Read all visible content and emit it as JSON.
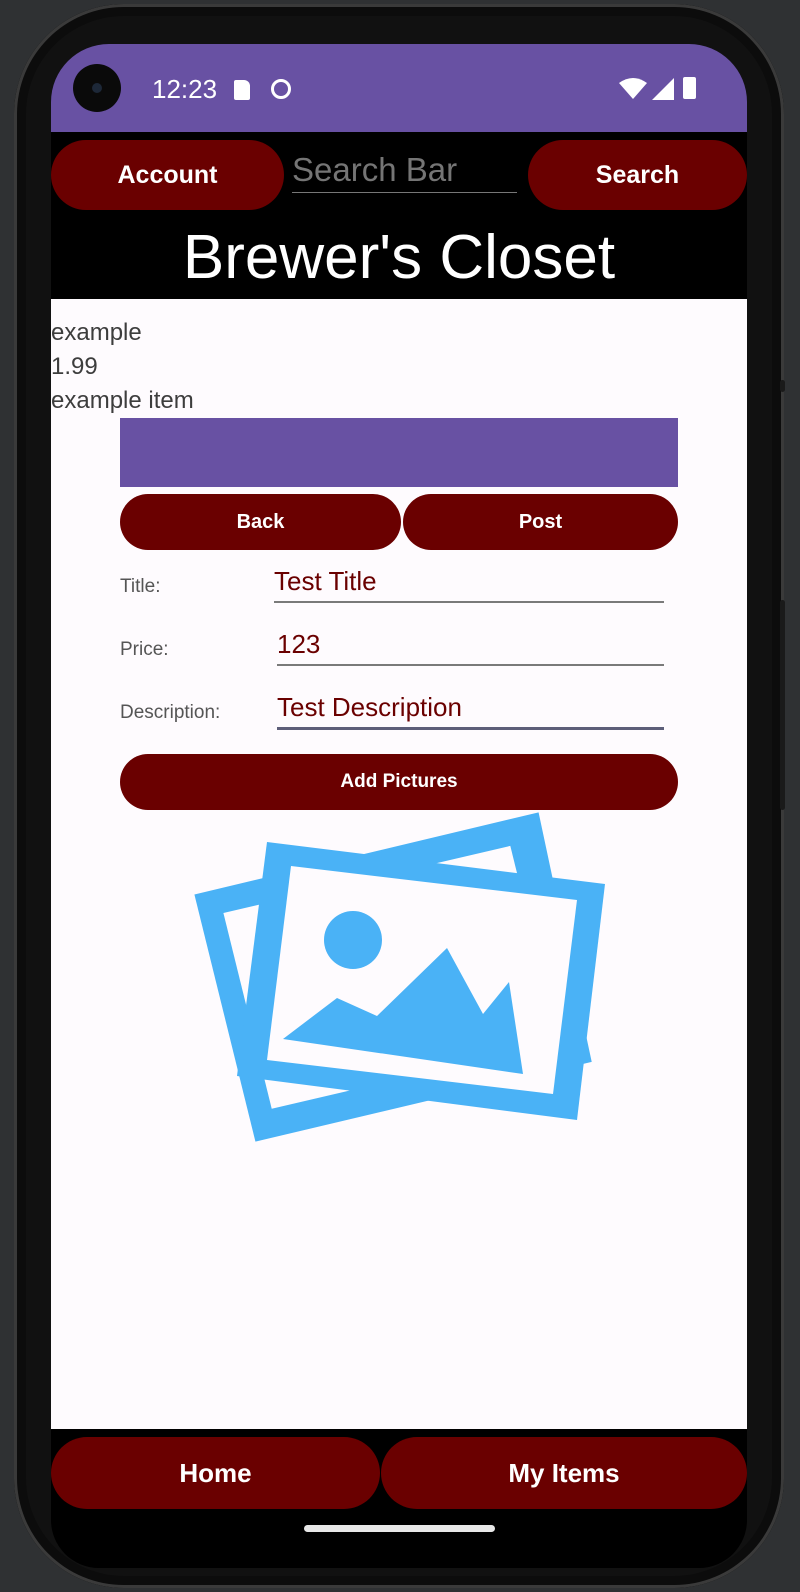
{
  "status_bar": {
    "time": "12:23",
    "color": "#6851a3"
  },
  "header": {
    "account_label": "Account",
    "search_placeholder": "Search Bar",
    "search_label": "Search",
    "app_title": "Brewer's Closet"
  },
  "item": {
    "name": "example",
    "price": "1.99",
    "description": "example item"
  },
  "actions": {
    "back_label": "Back",
    "post_label": "Post",
    "add_pictures_label": "Add Pictures"
  },
  "form": {
    "title_label": "Title:",
    "title_value": "Test Title",
    "price_label": "Price:",
    "price_value": "123",
    "description_label": "Description:",
    "description_value": "Test Description"
  },
  "bottom_nav": {
    "home_label": "Home",
    "my_items_label": "My Items"
  },
  "colors": {
    "button": "#6a0000",
    "accent": "#6851a3",
    "icon": "#4ab2f6"
  },
  "icons": [
    "camera-icon",
    "sd-card-icon",
    "face-icon",
    "wifi-icon",
    "signal-icon",
    "battery-icon",
    "gallery-icon"
  ]
}
